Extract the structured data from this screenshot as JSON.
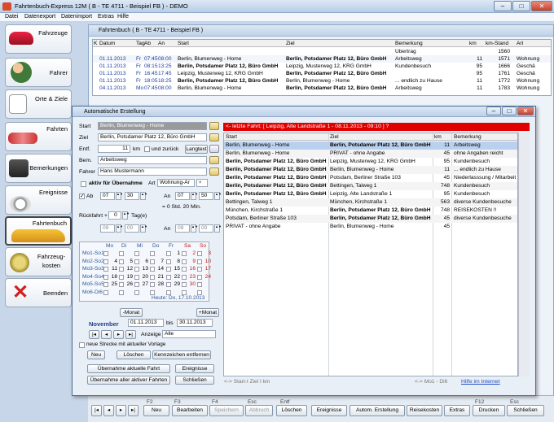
{
  "window": {
    "title": "Fahrtenbuch-Express 12M ( B - TE 4711 - Beispiel FB ) - DEMO"
  },
  "menu": [
    "Datei",
    "Datenexport",
    "Datenimport",
    "Extras",
    "Hilfe"
  ],
  "sidebar": [
    {
      "label": "Fahrzeuge",
      "icon": "car-icon"
    },
    {
      "label": "Fahrer",
      "icon": "people-icon"
    },
    {
      "label": "Orte & Ziele",
      "icon": "places-icon"
    },
    {
      "label": "Fahrten",
      "icon": "trips-icon"
    },
    {
      "label": "Bemerkungen",
      "icon": "notes-icon"
    },
    {
      "label": "Ereignisse",
      "icon": "events-icon"
    },
    {
      "label": "Fahrtenbuch",
      "icon": "logbook-car-icon"
    },
    {
      "label": "Fahrzeug- kosten",
      "icon": "coins-icon"
    },
    {
      "label": "Beenden",
      "icon": "exit-x-icon"
    }
  ],
  "main": {
    "title": "Fahrtenbuch ( B - TE 4711 - Beispiel FB )",
    "columns": [
      "K",
      "Datum",
      "Tag",
      "Ab",
      "An",
      "Start",
      "Ziel",
      "Bemerkung",
      "km",
      "km-Stand",
      "Art"
    ],
    "rows": [
      [
        "",
        "",
        "",
        "",
        "",
        "",
        "",
        "Übertrag",
        "",
        "1560",
        ""
      ],
      [
        "",
        "01.11.2013",
        "Fr",
        "07:45",
        "08:00",
        "Berlin, Blumenweg - Home",
        "Berlin, Potsdamer Platz 12, Büro GmbH",
        "Arbeitsweg",
        "11",
        "1571",
        "Wohnung"
      ],
      [
        "",
        "01.11.2013",
        "Fr",
        "08:15",
        "13:25",
        "Berlin, Potsdamer Platz 12, Büro GmbH",
        "Leipzig, Musterweg 12, KRG GmbH",
        "Kundenbesuch",
        "95",
        "1666",
        "Geschä"
      ],
      [
        "",
        "01.11.2013",
        "Fr",
        "16:45",
        "17:45",
        "Leipzig, Musterweg 12, KRG GmbH",
        "Berlin, Potsdamer Platz 12, Büro GmbH",
        "",
        "95",
        "1761",
        "Geschä"
      ],
      [
        "",
        "01.11.2013",
        "Fr",
        "18:05",
        "18:25",
        "Berlin, Potsdamer Platz 12, Büro GmbH",
        "Berlin, Blumenweg - Home",
        "... endlich zu Hause",
        "11",
        "1772",
        "Wohnung"
      ],
      [
        "",
        "04.11.2013",
        "Mo",
        "07:45",
        "08:00",
        "Berlin, Blumenweg - Home",
        "Berlin, Potsdamer Platz 12, Büro GmbH",
        "Arbeitsweg",
        "11",
        "1783",
        "Wohnung"
      ]
    ]
  },
  "dialog": {
    "title": "Automatische Erstellung",
    "start_label": "Start",
    "start_value": "Berlin, Blumenweg - Home",
    "ziel_label": "Ziel",
    "ziel_value": "Berlin, Potsdamer Platz 12, Büro GmbH",
    "entf_label": "Entf.",
    "entf_value": "11",
    "km_label": "km",
    "und_zurueck": "und zurück",
    "langtext": "Langtext",
    "bem_label": "Bem.",
    "bem_value": "Arbeitsweg",
    "fahrer_label": "Fahrer",
    "fahrer_value": "Hans Mustermann",
    "aktiv_label": "aktiv für Übernahme",
    "art_label": "Art",
    "art_value": "Wohnung-Ar",
    "ab_label": "Ab",
    "ab_h": "07",
    "ab_m": "30",
    "an_label": "An",
    "an_h": "07",
    "an_m": "50",
    "duration": "= 0 Std. 20 Min.",
    "rueckfahrt_label": "Rückfahrt +",
    "rueck_value": "0",
    "tage_label": "Tag(e)",
    "r_ab_h": "09",
    "r_ab_m": "00",
    "r_an_h": "09",
    "r_an_m": "00",
    "weekdays": [
      "Mo",
      "Di",
      "Mi",
      "Do",
      "Fr",
      "Sa",
      "So"
    ],
    "weeks": [
      {
        "label": "Mo1-So1",
        "days": [
          "",
          "",
          "",
          "",
          "1",
          "2",
          "3"
        ]
      },
      {
        "label": "Mo2-So2",
        "days": [
          "4",
          "5",
          "6",
          "7",
          "8",
          "9",
          "10"
        ]
      },
      {
        "label": "Mo3-So3",
        "days": [
          "11",
          "12",
          "13",
          "14",
          "15",
          "16",
          "17"
        ]
      },
      {
        "label": "Mo4-So4",
        "days": [
          "18",
          "19",
          "20",
          "21",
          "22",
          "23",
          "24"
        ]
      },
      {
        "label": "Mo5-So5",
        "days": [
          "25",
          "26",
          "27",
          "28",
          "29",
          "30",
          ""
        ]
      },
      {
        "label": "Mo6-Di6",
        "days": [
          "",
          "",
          "",
          "",
          "",
          "",
          ""
        ]
      }
    ],
    "heute": "Heute: Do, 17.10.2013",
    "minus_monat": "-Monat",
    "plus_monat": "+Monat",
    "month": "November",
    "from_date": "01.11.2013",
    "bis_label": "bis",
    "to_date": "30.11.2013",
    "anzeige_label": "Anzeige",
    "anzeige_value": "Alle",
    "neue_strecke": "neue Strecke mit aktueller Vorlage",
    "neu": "Neu",
    "loeschen": "Löschen",
    "kennzeichen": "Kennzeichen entfernen",
    "uebernahme_aktuell": "Übernahme aktuelle Fahrt",
    "ereignisse": "Ereignisse",
    "uebernahme_alle": "Übernahme aller aktiver Fahrten",
    "schliessen": "Schließen",
    "letzte_fahrt": "<- letzte Fahrt: [ Leipzig, Alte Landstraße 1 - 08.11.2013 - 09:10 ] ?",
    "grid_columns": [
      "Start",
      "Ziel",
      "km",
      "Bemerkung"
    ],
    "grid_rows": [
      [
        "Berlin, Blumenweg - Home",
        "Berlin, Potsdamer Platz 12, Büro GmbH",
        "11",
        "Arbeitsweg"
      ],
      [
        "Berlin, Blumenweg - Home",
        "PRIVAT - ohne Angabe",
        "45",
        "ohne Angaben reicht"
      ],
      [
        "Berlin, Potsdamer Platz 12, Büro GmbH",
        "Leipzig, Musterweg 12, KRG GmbH",
        "95",
        "Kundenbesuch"
      ],
      [
        "Berlin, Potsdamer Platz 12, Büro GmbH",
        "Berlin, Blumenweg - Home",
        "11",
        "... endlich zu Hause"
      ],
      [
        "Berlin, Potsdamer Platz 12, Büro GmbH",
        "Potsdam, Berliner Straße 103",
        "45",
        "Niederlasssung / Mitarbeit"
      ],
      [
        "Berlin, Potsdamer Platz 12, Büro GmbH",
        "Bettingen, Talweg 1",
        "748",
        "Kundenbesuch"
      ],
      [
        "Berlin, Potsdamer Platz 12, Büro GmbH",
        "Leipzig, Alte Landstraße 1",
        "95",
        "Kundenbesuch"
      ],
      [
        "Bettingen, Talweg 1",
        "München, Kirchstraße 1",
        "563",
        "diverse Kundenbesuche"
      ],
      [
        "München, Kirchstraße 1",
        "Berlin, Potsdamer Platz 12, Büro GmbH",
        "748",
        "REISEKOSTEN !!"
      ],
      [
        "Potsdam, Berliner Straße 103",
        "Berlin, Potsdamer Platz 12, Büro GmbH",
        "45",
        "diverse Kundenbesuche"
      ],
      [
        "PRIVAT - ohne Angabe",
        "Berlin, Blumenweg - Home",
        "45",
        ""
      ]
    ],
    "footer_left": "<-> Start-I Ziel I km",
    "footer_mid": "<-> Mo1 - Di6",
    "hilfe": "Hilfe im Internet"
  },
  "bottombar": {
    "fkeys": [
      "F2",
      "F3",
      "F4",
      "Esc",
      "Entf",
      "F12",
      "Esc"
    ],
    "buttons": [
      "Neu",
      "Bearbeiten",
      "Speichern",
      "Abbruch",
      "Löschen",
      "Ereignisse",
      "Autom. Erstellung",
      "Reisekosten",
      "Extras",
      "Drucken",
      "Schließen"
    ]
  }
}
